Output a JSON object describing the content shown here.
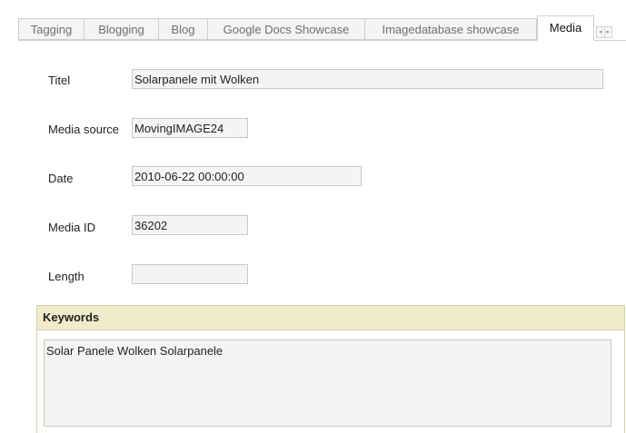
{
  "tabs": [
    {
      "label": "Tagging"
    },
    {
      "label": "Blogging"
    },
    {
      "label": "Blog"
    },
    {
      "label": "Google Docs Showcase"
    },
    {
      "label": "Imagedatabase showcase"
    },
    {
      "label": "Media"
    }
  ],
  "active_tab": "Media",
  "form": {
    "titel": {
      "label": "Titel",
      "value": "Solarpanele mit Wolken"
    },
    "media_source": {
      "label": "Media source",
      "value": "MovingIMAGE24"
    },
    "date": {
      "label": "Date",
      "value": "2010-06-22 00:00:00"
    },
    "media_id": {
      "label": "Media ID",
      "value": "36202"
    },
    "length": {
      "label": "Length",
      "value": ""
    }
  },
  "keywords": {
    "header": "Keywords",
    "value": "Solar Panele Wolken Solarpanele"
  },
  "icons": {
    "scroll_left": "◂",
    "scroll_right": "▸"
  }
}
